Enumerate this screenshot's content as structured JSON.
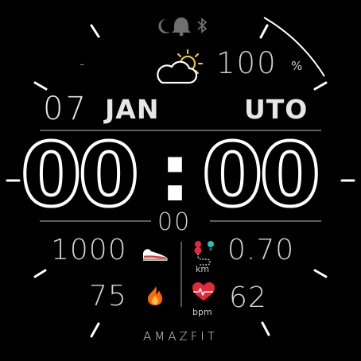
{
  "status": {
    "dnd_icon": "moon-icon",
    "alarm_icon": "bell-icon",
    "bluetooth_icon": "bluetooth-icon"
  },
  "weather": {
    "temperature": "-",
    "icon": "partly-cloudy-icon"
  },
  "battery": {
    "value": "100",
    "unit": "%"
  },
  "date": {
    "day": "07",
    "month": "JAN",
    "weekday": "UTO"
  },
  "time": {
    "hours": "00",
    "separator": ":",
    "minutes": "00",
    "seconds": "00"
  },
  "stats": {
    "steps": "1000",
    "distance": "0.70",
    "distance_unit": "km",
    "calories": "75",
    "heart_rate": "62",
    "heart_rate_unit": "bpm"
  },
  "brand": "AMAZFIT",
  "colors": {
    "accent_orange": "#ff6a00",
    "heart_red": "#e8283a",
    "shoe_red": "#e53935",
    "sun_yellow": "#f7d31a"
  }
}
